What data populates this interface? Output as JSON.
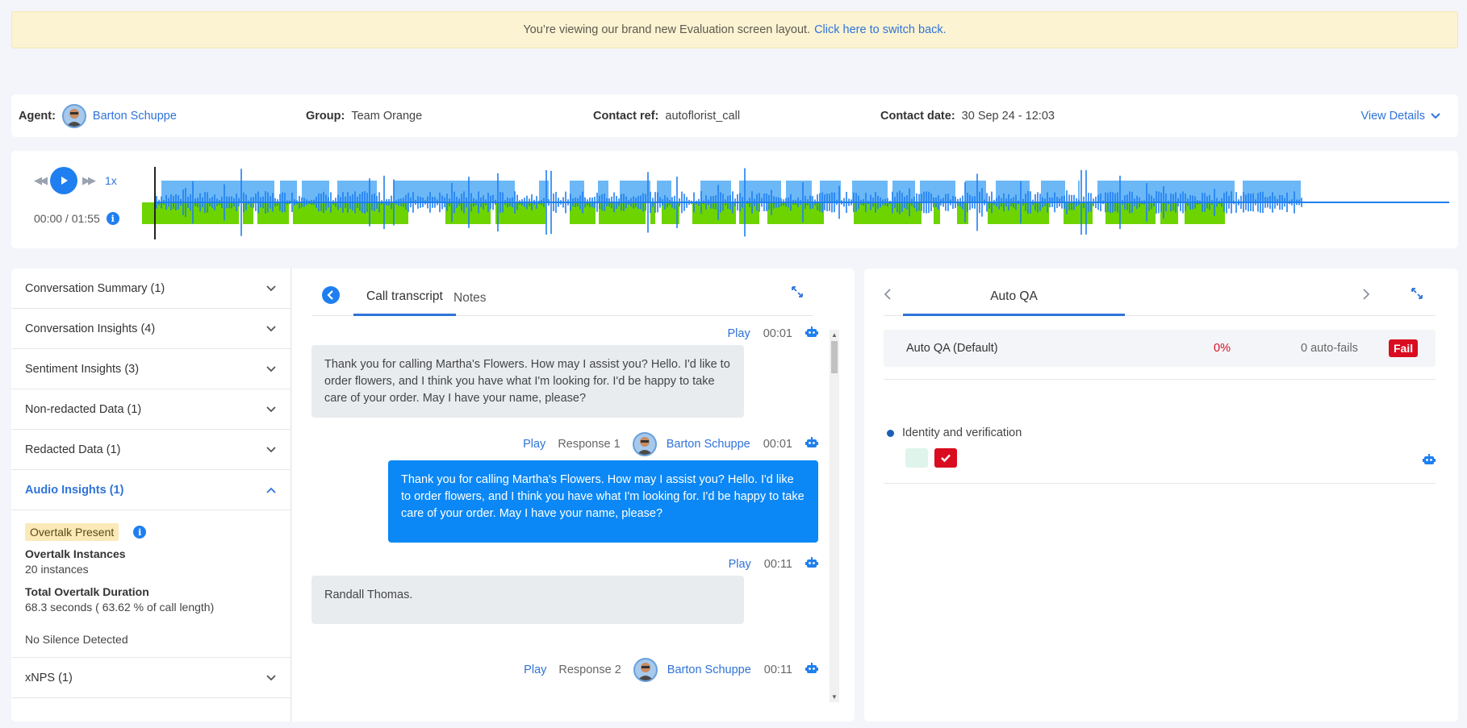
{
  "banner": {
    "text": "You’re viewing our brand new Evaluation screen layout.",
    "link": "Click here to switch back."
  },
  "info": {
    "agent_label": "Agent:",
    "agent_name": "Barton Schuppe",
    "group_label": "Group:",
    "group_value": "Team Orange",
    "contact_ref_label": "Contact ref:",
    "contact_ref_value": "autoflorist_call",
    "contact_date_label": "Contact date:",
    "contact_date_value": "30 Sep 24 - 12:03",
    "view_details": "View Details"
  },
  "player": {
    "speed": "1x",
    "time": "00:00 / 01:55",
    "colors": {
      "agent_track": "#6cb8f7",
      "customer_track": "#6dd400",
      "wave": "#1f7ff0"
    }
  },
  "left_panel": {
    "sections": [
      {
        "label": "Conversation Summary (1)"
      },
      {
        "label": "Conversation Insights (4)"
      },
      {
        "label": "Sentiment Insights (3)"
      },
      {
        "label": "Non-redacted Data (1)"
      },
      {
        "label": "Redacted Data (1)"
      },
      {
        "label": "Audio Insights (1)"
      },
      {
        "label": "xNPS (1)"
      }
    ],
    "audio": {
      "badge": "Overtalk Present",
      "overtalk_instances_title": "Overtalk Instances",
      "overtalk_instances_value": "20 instances",
      "duration_title": "Total Overtalk Duration",
      "duration_value": "68.3 seconds ( 63.62 % of call length)",
      "silence": "No Silence Detected"
    }
  },
  "transcript": {
    "tabs": [
      "Call transcript",
      "Notes"
    ],
    "play_label": "Play",
    "messages": [
      {
        "speaker": "customer",
        "time": "00:01",
        "text": "Thank you for calling Martha's Flowers. How may I assist you? Hello. I'd like to order flowers, and I think you have what I'm looking for. I'd be happy to take care of your order. May I have your name, please?"
      },
      {
        "speaker": "agent",
        "response": "Response 1",
        "agent": "Barton Schuppe",
        "time": "00:01",
        "text": "Thank you for calling Martha's Flowers. How may I assist you? Hello. I'd like to order flowers, and I think you have what I'm looking for. I'd be happy to take care of your order. May I have your name, please?"
      },
      {
        "speaker": "customer",
        "time": "00:11",
        "text": "Randall Thomas."
      },
      {
        "speaker": "agent",
        "response": "Response 2",
        "agent": "Barton Schuppe",
        "time": "00:11",
        "text": ""
      }
    ]
  },
  "qa": {
    "tab": "Auto QA",
    "row_name": "Auto QA (Default)",
    "row_pct": "0%",
    "row_fails": "0 auto-fails",
    "row_badge": "Fail",
    "criterion": "Identity and verification"
  }
}
